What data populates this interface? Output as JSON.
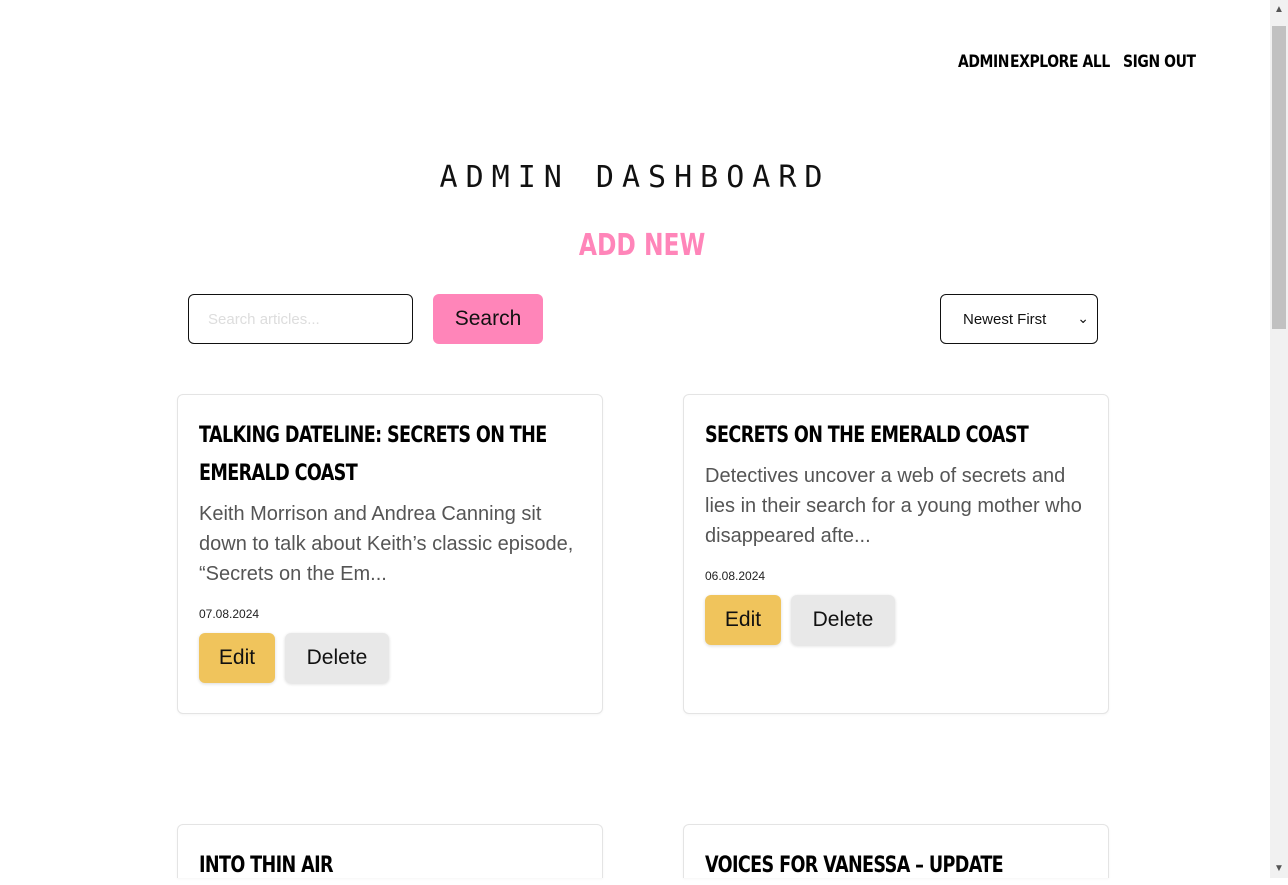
{
  "nav": {
    "admin": "ADMIN",
    "explore_all": "EXPLORE ALL",
    "sign_out": "SIGN OUT"
  },
  "page_title": "ADMIN DASHBOARD",
  "add_new": "ADD NEW",
  "search": {
    "placeholder": "Search articles...",
    "value": "",
    "button_label": "Search"
  },
  "sort": {
    "selected": "Newest First"
  },
  "articles": [
    {
      "title": "TALKING DATELINE: SECRETS ON THE EMERALD COAST",
      "excerpt": "Keith Morrison and Andrea Canning sit down to talk about Keith’s classic episode, “Secrets on the Em...",
      "date": "07.08.2024",
      "edit_label": "Edit",
      "delete_label": "Delete"
    },
    {
      "title": "SECRETS ON THE EMERALD COAST",
      "excerpt": "Detectives uncover a web of secrets and lies in their search for a young mother who disappeared afte...",
      "date": "06.08.2024",
      "edit_label": "Edit",
      "delete_label": "Delete"
    },
    {
      "title": "INTO THIN AIR"
    },
    {
      "title": "VOICES FOR VANESSA – UPDATE"
    }
  ],
  "colors": {
    "accent_pink": "#ff85b9",
    "edit_yellow": "#f0c45c",
    "delete_gray": "#e8e8e8"
  }
}
